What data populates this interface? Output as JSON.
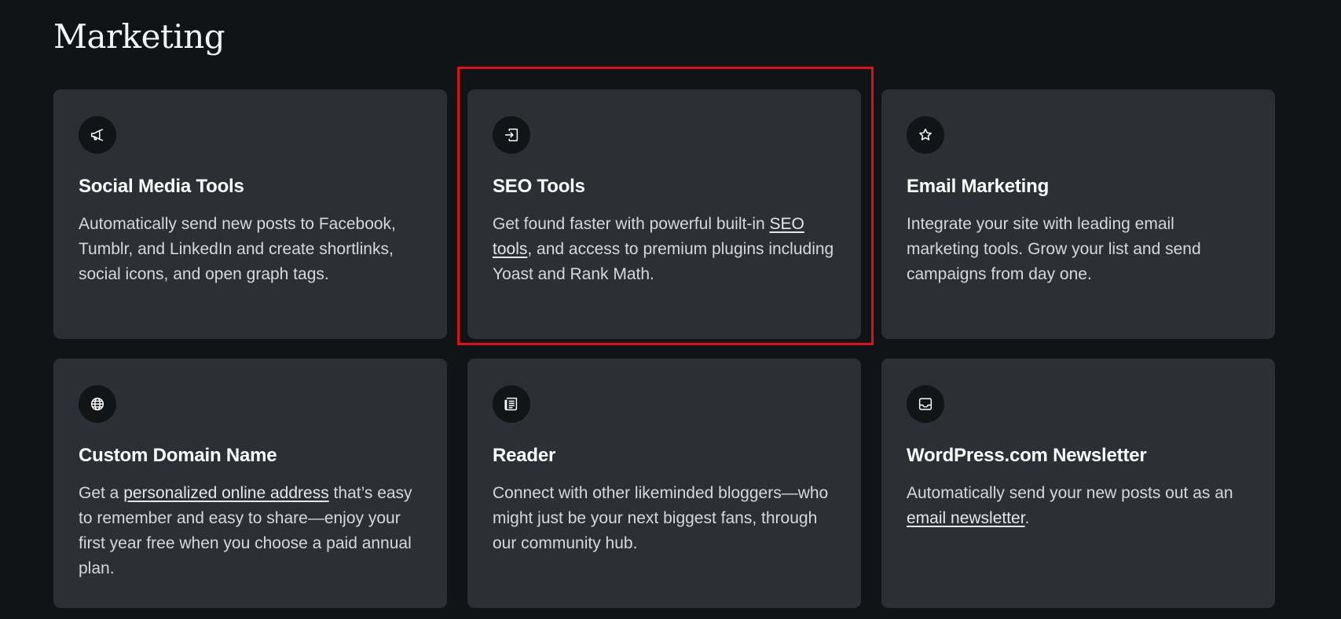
{
  "section": {
    "title": "Marketing"
  },
  "highlight_color": "#e0101a",
  "cards": [
    {
      "icon": "megaphone-icon",
      "title": "Social Media Tools",
      "desc": "Automatically send new posts to Facebook, Tumblr, and LinkedIn and create shortlinks, social icons, and open graph tags."
    },
    {
      "icon": "seo-login-icon",
      "title": "SEO Tools",
      "desc_before": "Get found faster with powerful built-in ",
      "link": "SEO tools",
      "desc_after": ", and access to premium plugins including Yoast and Rank Math."
    },
    {
      "icon": "star-icon",
      "title": "Email Marketing",
      "desc": "Integrate your site with leading email marketing tools. Grow your list and send campaigns from day one."
    },
    {
      "icon": "globe-icon",
      "title": "Custom Domain Name",
      "desc_before": "Get a ",
      "link": "personalized online address",
      "desc_after": " that’s easy to remember and easy to share—enjoy your first year free when you choose a paid annual plan."
    },
    {
      "icon": "reader-icon",
      "title": "Reader",
      "desc": "Connect with other likeminded bloggers—who might just be your next biggest fans, through our community hub."
    },
    {
      "icon": "inbox-icon",
      "title": "WordPress.com Newsletter",
      "desc_before": "Automatically send your new posts out as an ",
      "link": "email newsletter",
      "desc_after": "."
    }
  ]
}
